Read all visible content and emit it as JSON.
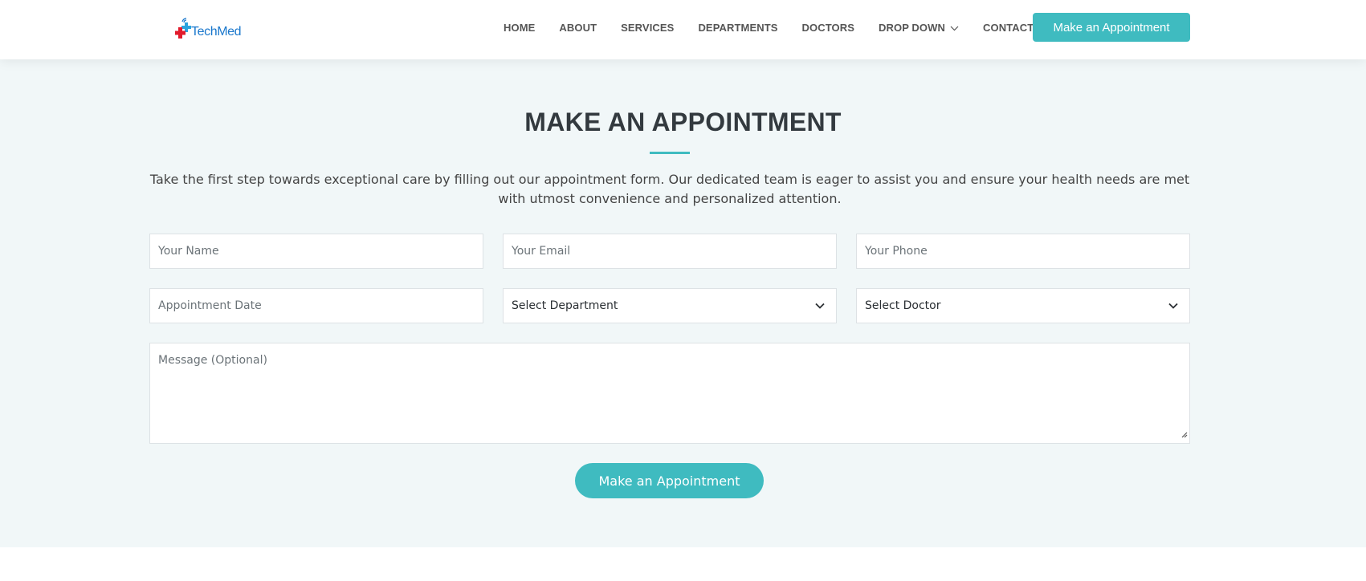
{
  "header": {
    "logo_text": "TechMed",
    "nav": [
      {
        "label": "HOME"
      },
      {
        "label": "ABOUT"
      },
      {
        "label": "SERVICES"
      },
      {
        "label": "DEPARTMENTS"
      },
      {
        "label": "DOCTORS"
      },
      {
        "label": "DROP DOWN"
      },
      {
        "label": "CONTACT"
      }
    ],
    "cta_label": "Make an Appointment"
  },
  "appointment": {
    "title": "MAKE AN APPOINTMENT",
    "description": "Take the first step towards exceptional care by filling out our appointment form. Our dedicated team is eager to assist you and ensure your health needs are met with utmost convenience and personalized attention.",
    "fields": {
      "name_placeholder": "Your Name",
      "email_placeholder": "Your Email",
      "phone_placeholder": "Your Phone",
      "date_placeholder": "Appointment Date",
      "department_selected": "Select Department",
      "doctor_selected": "Select Doctor",
      "message_placeholder": "Message (Optional)"
    },
    "submit_label": "Make an Appointment"
  },
  "colors": {
    "accent": "#3fbbc0",
    "logo_blue": "#1977cc",
    "logo_red": "#e21b2c",
    "section_bg": "#f1f7f8"
  },
  "icons": {
    "logo": "medical-cross-logo-icon",
    "dropdown": "chevron-down-icon",
    "resize": "resize-handle-icon"
  }
}
